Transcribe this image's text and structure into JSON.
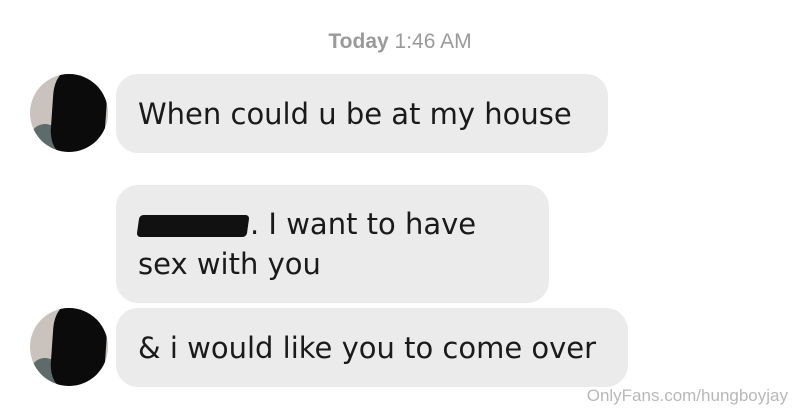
{
  "timestamp": {
    "day": "Today",
    "time": "1:46 AM"
  },
  "messages": [
    {
      "text": "When could u be at my house"
    },
    {
      "text": ". I want to have sex with you"
    },
    {
      "text": "& i would like you to come over"
    }
  ],
  "watermark": "OnlyFans.com/hungboyjay",
  "colors": {
    "bubble": "#ebebeb",
    "timestamp": "#9a9a9a",
    "text": "#1a1a1a"
  }
}
